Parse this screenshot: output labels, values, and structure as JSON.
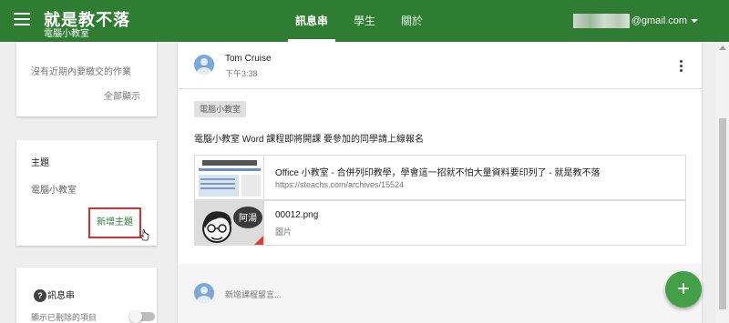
{
  "topbar": {
    "title": "就是教不落",
    "subtitle": "電腦小教室",
    "tabs": [
      {
        "label": "訊息串",
        "active": true
      },
      {
        "label": "學生",
        "active": false
      },
      {
        "label": "關於",
        "active": false
      }
    ],
    "account_suffix": "@gmail.com",
    "color": "#2e7d32"
  },
  "sidebar": {
    "due": {
      "text": "沒有近期內要繳交的作業",
      "link": "全部顯示"
    },
    "topics": {
      "heading": "主題",
      "items": [
        "電腦小教室"
      ],
      "add_label": "新增主題"
    },
    "stream": {
      "heading": "訊息串",
      "toggle_label": "顯示已刪除的項目",
      "toggle_on": false
    }
  },
  "post": {
    "author": "Tom Cruise",
    "time": "下午3:38",
    "topic": "電腦小教室",
    "body": "電腦小教室 Word 課程即將開課 要參加的同學請上線報名",
    "attachments": [
      {
        "title": "Office 小教室 - 合併列印教學，學會這一招就不怕大量資料要印列了 - 就是教不落",
        "subtitle": "https://steachs.com/archives/15524",
        "thumb_header": "就是教不落"
      },
      {
        "title": "00012.png",
        "subtitle": "圖片",
        "thumb_text": "阿湯"
      }
    ]
  },
  "comment": {
    "placeholder": "新增課程留言..."
  },
  "fab": {
    "label": "+"
  }
}
